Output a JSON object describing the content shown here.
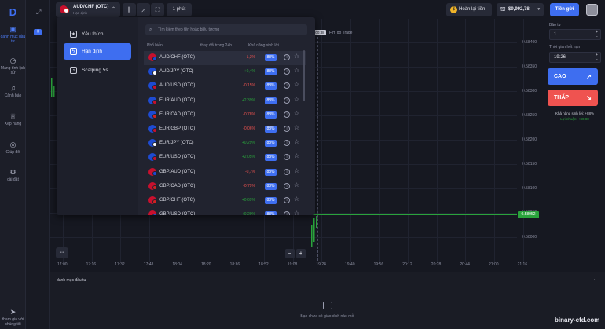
{
  "rail": {
    "items": [
      {
        "label": "danh mục đầu tư",
        "icon": "briefcase-icon"
      },
      {
        "label": "Mạng tính lịch sử",
        "icon": "clock-icon"
      },
      {
        "label": "Cảnh báo",
        "icon": "bell-icon"
      },
      {
        "label": "Xếp hạng",
        "icon": "trophy-icon"
      },
      {
        "label": "Giúp đỡ",
        "icon": "lifebuoy-icon"
      },
      {
        "label": "cài đặt",
        "icon": "gear-icon"
      },
      {
        "label": "tham gia với chúng tôi",
        "icon": "send-icon"
      }
    ]
  },
  "topbar": {
    "asset_name": "AUD/CHF (OTC)",
    "asset_sub": "Hạn định",
    "timeframe": "1 phút",
    "refund_label": "Hoàn lại tiền",
    "balance": "$9,992,78",
    "deposit_label": "Tiền gửi"
  },
  "chart": {
    "y_ticks": [
      "0.58400",
      "0.58350",
      "0.58300",
      "0.58250",
      "0.58200",
      "0.58150",
      "0.58100",
      "0.58050",
      "0.58000"
    ],
    "x_ticks": [
      "17:00",
      "17:16",
      "17:32",
      "17:48",
      "18:04",
      "18:20",
      "18:36",
      "18:52",
      "19:08",
      "19:24",
      "19:40",
      "19:56",
      "20:12",
      "20:28",
      "20:44",
      "21:00",
      "21:16"
    ],
    "current_price": "0.58052",
    "trade_time_tag": "00:38",
    "trade_label": "Fim do Trade",
    "accent": "#2aa33c"
  },
  "panel": {
    "invest_label": "Bảo tư",
    "invest_value": "1",
    "expiry_label": "Thời gian hết hạn",
    "expiry_value": "19:26",
    "up_label": "CAO",
    "down_label": "THẤP",
    "payout_label": "Khả năng sinh lời: +88%",
    "profit_label": "Lợi nhuận: +$0,88",
    "up_color": "#3e6ef0",
    "down_color": "#ef5350"
  },
  "dropdown": {
    "categories": [
      {
        "label": "Yêu thích",
        "icon": "star-icon"
      },
      {
        "label": "Hạn định",
        "icon": "bolt-icon"
      },
      {
        "label": "Scalping 5s",
        "icon": "timer-icon"
      }
    ],
    "search_placeholder": "Tìm kiếm theo tên hoặc biểu tượng",
    "col_name": "Phổ biến",
    "col_change": "thay đổi trong 24h",
    "col_payout": "Khả năng sinh lời",
    "rows": [
      {
        "name": "AUD/CHF (OTC)",
        "change": "-1,3%",
        "payout": "88%",
        "dir": "neg",
        "c1": "#c8102e",
        "c2": "#1e4bd2"
      },
      {
        "name": "AUD/JPY (OTC)",
        "change": "+0,4%",
        "payout": "88%",
        "dir": "pos",
        "c1": "#1e4bd2",
        "c2": "#ffffff"
      },
      {
        "name": "AUD/USD (OTC)",
        "change": "-0,15%",
        "payout": "88%",
        "dir": "neg",
        "c1": "#1e4bd2",
        "c2": "#c8102e"
      },
      {
        "name": "EUR/AUD (OTC)",
        "change": "+2,39%",
        "payout": "88%",
        "dir": "pos",
        "c1": "#1e4bd2",
        "c2": "#c8102e"
      },
      {
        "name": "EUR/CAD (OTC)",
        "change": "-0,78%",
        "payout": "88%",
        "dir": "neg",
        "c1": "#1e4bd2",
        "c2": "#d22222"
      },
      {
        "name": "EUR/GBP (OTC)",
        "change": "-0,06%",
        "payout": "88%",
        "dir": "neg",
        "c1": "#1e4bd2",
        "c2": "#c8102e"
      },
      {
        "name": "EUR/JPY (OTC)",
        "change": "+0,29%",
        "payout": "88%",
        "dir": "pos",
        "c1": "#1e4bd2",
        "c2": "#ffffff"
      },
      {
        "name": "EUR/USD (OTC)",
        "change": "+2,05%",
        "payout": "88%",
        "dir": "pos",
        "c1": "#1e4bd2",
        "c2": "#c8102e"
      },
      {
        "name": "GBP/AUD (OTC)",
        "change": "-0,7%",
        "payout": "88%",
        "dir": "neg",
        "c1": "#c8102e",
        "c2": "#1e4bd2"
      },
      {
        "name": "GBP/CAD (OTC)",
        "change": "-0,79%",
        "payout": "88%",
        "dir": "neg",
        "c1": "#c8102e",
        "c2": "#d22222"
      },
      {
        "name": "GBP/CHF (OTC)",
        "change": "+0,69%",
        "payout": "88%",
        "dir": "pos",
        "c1": "#c8102e",
        "c2": "#d22222"
      },
      {
        "name": "GBP/USD (OTC)",
        "change": "+0,29%",
        "payout": "88%",
        "dir": "pos",
        "c1": "#c8102e",
        "c2": "#1e4bd2"
      }
    ]
  },
  "bottom": {
    "title": "danh mục đầu tư",
    "empty_text": "Bạn chưa có giao dịch nào mở"
  },
  "footer": "binary-cfd.com"
}
